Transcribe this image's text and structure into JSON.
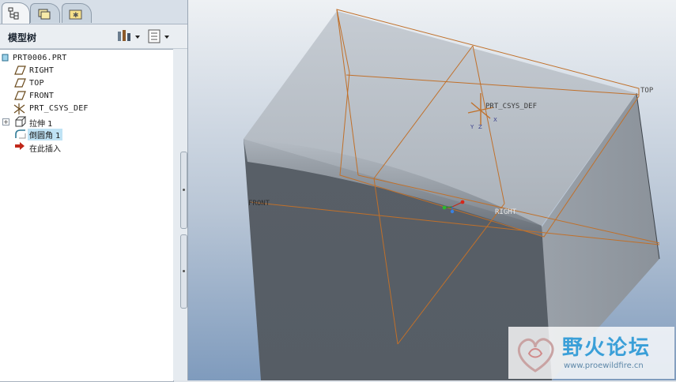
{
  "navigator": {
    "tabs": [
      {
        "icon": "model-tree-icon",
        "active": true
      },
      {
        "icon": "folder-browser-icon",
        "active": false
      },
      {
        "icon": "favorites-icon",
        "active": false
      }
    ],
    "title": "模型树",
    "settings_icon": "tree-settings-icon",
    "show_icon": "tree-show-icon"
  },
  "tree": {
    "root": "PRT0006.PRT",
    "items": [
      {
        "label": "RIGHT",
        "icon": "datum-plane-icon"
      },
      {
        "label": "TOP",
        "icon": "datum-plane-icon"
      },
      {
        "label": "FRONT",
        "icon": "datum-plane-icon"
      },
      {
        "label": "PRT_CSYS_DEF",
        "icon": "coordinate-system-icon"
      },
      {
        "label": "拉伸 1",
        "icon": "extrude-icon",
        "expandable": true
      },
      {
        "label": "倒圆角 1",
        "icon": "round-icon",
        "selected": true
      },
      {
        "label": "在此插入",
        "icon": "insert-here-arrow-icon"
      }
    ]
  },
  "viewport": {
    "labels": {
      "top": "TOP",
      "front": "FRONT",
      "right": "RIGHT",
      "csys": "PRT_CSYS_DEF",
      "csys_x": "X",
      "csys_y": "Y",
      "csys_z": "Z"
    },
    "colors": {
      "datum": "#c0702a",
      "background_top": "#eef1f4",
      "background_bottom": "#7f9bbd"
    }
  },
  "watermark": {
    "cn": "野火论坛",
    "url": "www.proewildfire.cn"
  }
}
